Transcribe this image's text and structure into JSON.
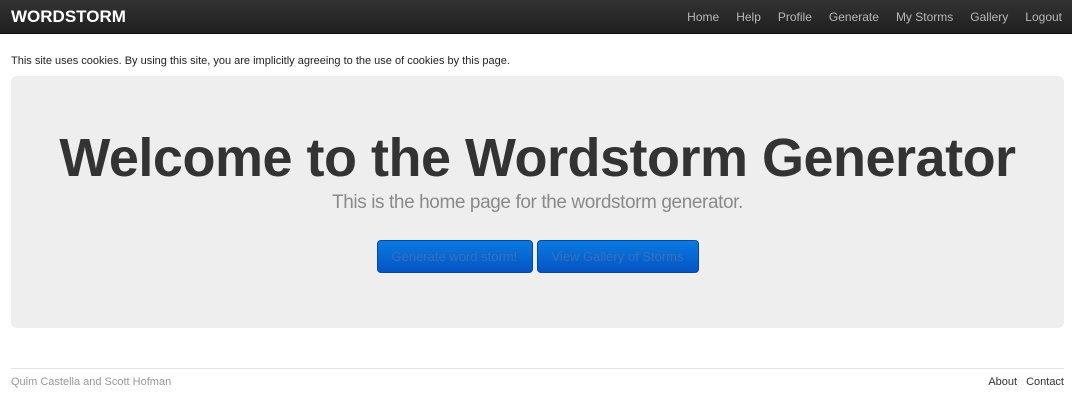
{
  "navbar": {
    "brand": "WORDSTORM",
    "links": [
      "Home",
      "Help",
      "Profile",
      "Generate",
      "My Storms",
      "Gallery",
      "Logout"
    ]
  },
  "cookie_notice": "This site uses cookies. By using this site, you are implicitly agreeing to the use of cookies by this page.",
  "hero": {
    "title": "Welcome to the Wordstorm Generator",
    "subtitle": "This is the home page for the wordstorm generator.",
    "buttons": [
      "Generate word storm!",
      "View Gallery of Storms"
    ]
  },
  "footer": {
    "credit": "Quim Castella and Scott Hofman",
    "links": [
      "About",
      "Contact"
    ]
  },
  "colors": {
    "navbar_bg": "#222222",
    "hero_bg": "#eeeeee",
    "button_bg": "#0665d0"
  }
}
